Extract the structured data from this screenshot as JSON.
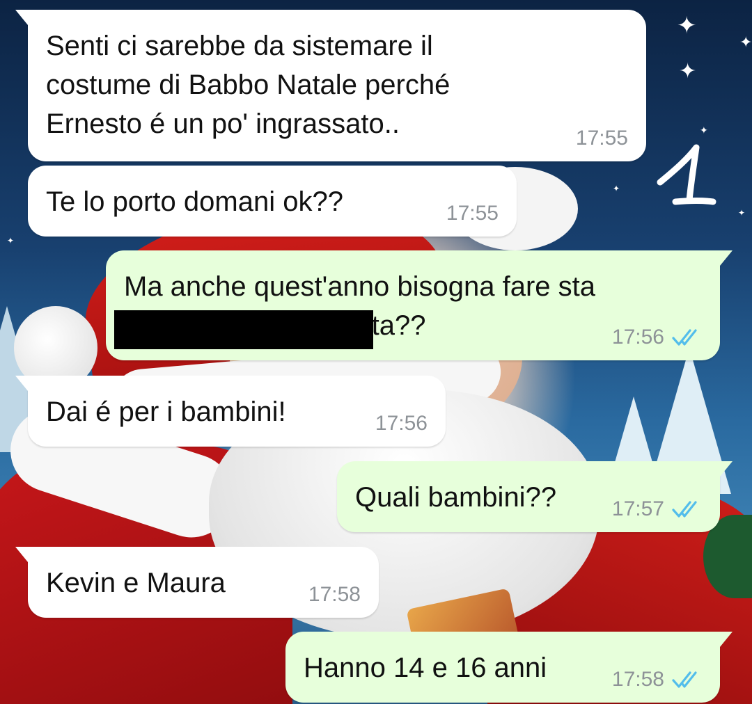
{
  "chat": {
    "messages": [
      {
        "direction": "in",
        "text": "Senti ci sarebbe da sistemare il\ncostume di Babbo Natale perché\nErnesto é un po' ingrassato..",
        "time": "17:55",
        "ticks": false
      },
      {
        "direction": "in",
        "text": "Te lo porto domani ok??",
        "time": "17:55",
        "ticks": false
      },
      {
        "direction": "out",
        "text": "Ma anche quest'anno bisogna fare sta\n                              ata??",
        "time": "17:56",
        "ticks": true,
        "redacted": true
      },
      {
        "direction": "in",
        "text": "Dai é per i bambini!",
        "time": "17:56",
        "ticks": false
      },
      {
        "direction": "out",
        "text": "Quali bambini??",
        "time": "17:57",
        "ticks": true
      },
      {
        "direction": "in",
        "text": "Kevin e Maura",
        "time": "17:58",
        "ticks": false
      },
      {
        "direction": "out",
        "text": "Hanno 14 e 16 anni",
        "time": "17:58",
        "ticks": true
      }
    ],
    "read_receipt_icon": "double-check-icon",
    "read_receipt_color": "#53bdeb"
  },
  "colors": {
    "incoming_bubble": "#ffffff",
    "outgoing_bubble": "#e7ffdb",
    "timestamp": "#8d9297"
  },
  "wallpaper": {
    "theme": "santa-claus-christmas",
    "handwritten_mark": "1"
  }
}
